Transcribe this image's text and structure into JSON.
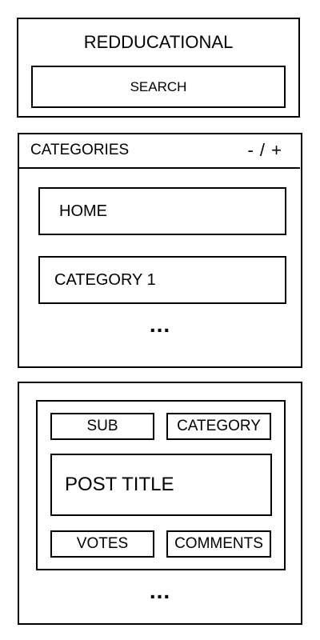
{
  "header": {
    "title": "REDDUCATIONAL",
    "search_label": "SEARCH"
  },
  "categories": {
    "title": "CATEGORIES",
    "toggle_label": "- / +",
    "items": [
      {
        "label": "HOME"
      },
      {
        "label": "CATEGORY 1"
      }
    ],
    "more_indicator": "..."
  },
  "posts": {
    "card": {
      "sub_label": "SUB",
      "category_label": "CATEGORY",
      "title": "POST TITLE",
      "votes_label": "VOTES",
      "comments_label": "COMMENTS"
    },
    "more_indicator": "..."
  }
}
